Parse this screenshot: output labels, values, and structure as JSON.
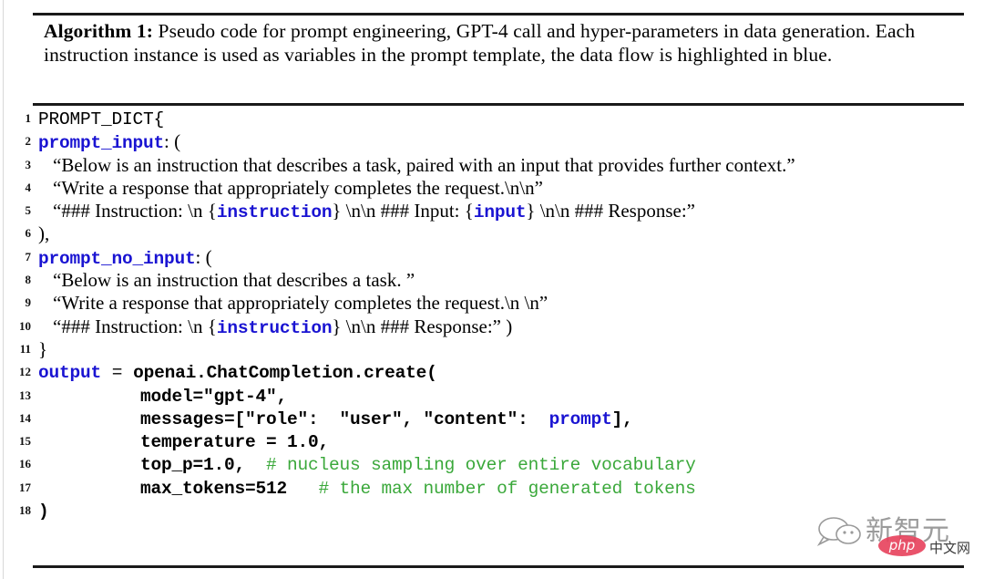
{
  "document": {
    "type": "algorithm-figure",
    "algorithm_label": "Algorithm 1:",
    "caption_text": " Pseudo code for prompt engineering, GPT-4 call and hyper-parameters in data generation. Each instruction instance is used as variables in the prompt template, the data flow is highlighted in blue."
  },
  "colors": {
    "highlight_blue": "#1a14d2",
    "comment_green": "#3aa83a",
    "text_black": "#000000",
    "rule": "#1a1a1a",
    "watermark_red": "#e8455f"
  },
  "code": {
    "lines": [
      {
        "no": "1",
        "indent": 0,
        "tokens": [
          {
            "text": "PROMPT_DICT{",
            "style": "mono"
          }
        ]
      },
      {
        "no": "2",
        "indent": 0,
        "tokens": [
          {
            "text": "prompt_input",
            "style": "mono-b blue"
          },
          {
            "text": ": (",
            "style": "serif"
          }
        ]
      },
      {
        "no": "3",
        "indent": 1,
        "tokens": [
          {
            "text": "“Below is an instruction that describes a task, paired with an input that provides further context.”",
            "style": "serif"
          }
        ]
      },
      {
        "no": "4",
        "indent": 1,
        "tokens": [
          {
            "text": "“Write a response that appropriately completes the request.\\n\\n”",
            "style": "serif"
          }
        ]
      },
      {
        "no": "5",
        "indent": 1,
        "tokens": [
          {
            "text": "“### Instruction: \\n {",
            "style": "serif"
          },
          {
            "text": "instruction",
            "style": "mono-b blue"
          },
          {
            "text": "} \\n\\n ### Input: {",
            "style": "serif"
          },
          {
            "text": "input",
            "style": "mono-b blue"
          },
          {
            "text": "} \\n\\n ### Response:”",
            "style": "serif"
          }
        ]
      },
      {
        "no": "6",
        "indent": 0,
        "tokens": [
          {
            "text": "),",
            "style": "serif"
          }
        ]
      },
      {
        "no": "7",
        "indent": 0,
        "tokens": [
          {
            "text": "prompt_no_input",
            "style": "mono-b blue"
          },
          {
            "text": ": (",
            "style": "serif"
          }
        ]
      },
      {
        "no": "8",
        "indent": 1,
        "tokens": [
          {
            "text": "“Below is an instruction that describes a task. ”",
            "style": "serif"
          }
        ]
      },
      {
        "no": "9",
        "indent": 1,
        "tokens": [
          {
            "text": "“Write a response that appropriately completes the request.\\n \\n”",
            "style": "serif"
          }
        ]
      },
      {
        "no": "10",
        "indent": 1,
        "tokens": [
          {
            "text": "“### Instruction: \\n {",
            "style": "serif"
          },
          {
            "text": "instruction",
            "style": "mono-b blue"
          },
          {
            "text": "} \\n\\n ### Response:” )",
            "style": "serif"
          }
        ]
      },
      {
        "no": "11",
        "indent": 0,
        "tokens": [
          {
            "text": "}",
            "style": "serif"
          }
        ]
      },
      {
        "no": "12",
        "indent": 0,
        "tokens": [
          {
            "text": "output",
            "style": "mono-b blue"
          },
          {
            "text": " = ",
            "style": "thin"
          },
          {
            "text": "openai.ChatCompletion.create(",
            "style": "mono-b"
          }
        ]
      },
      {
        "no": "13",
        "indent": 2,
        "tokens": [
          {
            "text": "model=\"gpt-4\",",
            "style": "mono-b"
          }
        ]
      },
      {
        "no": "14",
        "indent": 2,
        "tokens": [
          {
            "text": "messages=[\"role\":  \"user\", \"content\":  ",
            "style": "mono-b"
          },
          {
            "text": "prompt",
            "style": "mono-b blue"
          },
          {
            "text": "],",
            "style": "mono-b"
          }
        ]
      },
      {
        "no": "15",
        "indent": 2,
        "tokens": [
          {
            "text": "temperature = 1.0,",
            "style": "mono-b"
          }
        ]
      },
      {
        "no": "16",
        "indent": 2,
        "tokens": [
          {
            "text": "top_p=1.0,",
            "style": "mono-b"
          },
          {
            "text": "  # nucleus sampling over entire vocabulary",
            "style": "mono green"
          }
        ]
      },
      {
        "no": "17",
        "indent": 2,
        "tokens": [
          {
            "text": "max_tokens=512",
            "style": "mono-b"
          },
          {
            "text": "   # the max number of generated tokens",
            "style": "mono green"
          }
        ]
      },
      {
        "no": "18",
        "indent": 0,
        "tokens": [
          {
            "text": ")",
            "style": "mono-b"
          }
        ]
      }
    ]
  },
  "watermark": {
    "brand_cn": "新智元",
    "php_label": "php",
    "site_cn": "中文网"
  }
}
